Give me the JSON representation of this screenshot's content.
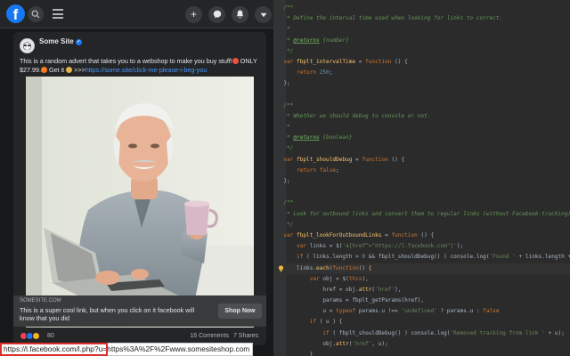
{
  "facebook": {
    "logo": "f",
    "nav_icons": [
      "search-icon",
      "menu-icon",
      "plus-icon",
      "messenger-icon",
      "notifications-icon",
      "account-caret-icon"
    ],
    "post": {
      "author": "Some Site",
      "text_before": "This is a random advert that takes you to a webshop to make you buy stuff!",
      "text_price": " ONLY $27.99.",
      "text_getit": " Get it ",
      "text_arrows": " >>>",
      "link_text": "https://some.site/click-me-please-i-beg-you",
      "ad_domain": "SOMESITE.COM",
      "ad_title": "This is a super cool link, but when you click on it facebook will know that you did",
      "ad_button": "Shop Now",
      "reaction_count": "80",
      "comments": "16 Comments",
      "shares": "7 Shares"
    },
    "status_url": "https://l.facebook.com/l.php?u=https%3A%2F%2Fwww.somesiteshop.com",
    "colors": {
      "facebook_blue": "#1877f2",
      "link": "#4599ff",
      "highlight_box": "#d9302c"
    }
  },
  "editor": {
    "lines": [
      [
        [
          "c-doc",
          "/**"
        ]
      ],
      [
        [
          "c-doc",
          " * Define the interval time used when looking for links to correct."
        ]
      ],
      [
        [
          "c-doc",
          " *"
        ]
      ],
      [
        [
          "c-doc",
          " * "
        ],
        [
          "c-tag",
          "@returns"
        ],
        [
          "c-doc",
          " {number}"
        ]
      ],
      [
        [
          "c-doc",
          " */"
        ]
      ],
      [
        [
          "c-kw",
          "var "
        ],
        [
          "c-fn",
          "fbplt_intervalTime"
        ],
        [
          "",
          " = "
        ],
        [
          "c-kw",
          "function"
        ],
        [
          "",
          " () {"
        ]
      ],
      [
        [
          "",
          "    "
        ],
        [
          "c-kw",
          "return "
        ],
        [
          "c-num",
          "250"
        ],
        [
          "",
          ";"
        ]
      ],
      [
        [
          "",
          "};"
        ]
      ],
      [
        [
          "",
          ""
        ]
      ],
      [
        [
          "c-doc",
          "/**"
        ]
      ],
      [
        [
          "c-doc",
          " * Whether we should debug to console or not."
        ]
      ],
      [
        [
          "c-doc",
          " *"
        ]
      ],
      [
        [
          "c-doc",
          " * "
        ],
        [
          "c-tag",
          "@returns"
        ],
        [
          "c-doc",
          " {boolean}"
        ]
      ],
      [
        [
          "c-doc",
          " */"
        ]
      ],
      [
        [
          "c-kw",
          "var "
        ],
        [
          "c-fn",
          "fbplt_shouldDebug"
        ],
        [
          "",
          " = "
        ],
        [
          "c-kw",
          "function"
        ],
        [
          "",
          " () {"
        ]
      ],
      [
        [
          "",
          "    "
        ],
        [
          "c-kw",
          "return false"
        ],
        [
          "",
          ";"
        ]
      ],
      [
        [
          "",
          "};"
        ]
      ],
      [
        [
          "",
          ""
        ]
      ],
      [
        [
          "c-doc",
          "/**"
        ]
      ],
      [
        [
          "c-doc",
          " * Look for outbound links and convert them to regular links (without Facebook-tracking)."
        ]
      ],
      [
        [
          "c-doc",
          " */"
        ]
      ],
      [
        [
          "c-kw",
          "var "
        ],
        [
          "c-fn",
          "fbplt_lookForOutboundLinks"
        ],
        [
          "",
          " = "
        ],
        [
          "c-kw",
          "function"
        ],
        [
          "",
          " () {"
        ]
      ],
      [
        [
          "",
          "    "
        ],
        [
          "c-kw",
          "var "
        ],
        [
          "",
          "links = $("
        ],
        [
          "c-str",
          "'a[href^=\"https://l.facebook.com\"]'"
        ],
        [
          "",
          ");"
        ]
      ],
      [
        [
          "",
          "    "
        ],
        [
          "c-kw",
          "if "
        ],
        [
          "",
          "( links.length > "
        ],
        [
          "c-num",
          "0"
        ],
        [
          "",
          " && fbplt_shouldDebug() ) console.log("
        ],
        [
          "c-str",
          "'Found '"
        ],
        [
          "",
          " + links.length + "
        ],
        [
          "c-str",
          "' links t"
        ]
      ],
      [
        [
          "",
          "    links."
        ],
        [
          "c-fn",
          "each"
        ],
        [
          "",
          "("
        ],
        [
          "c-kw",
          "function"
        ],
        [
          "",
          "() "
        ],
        [
          "c-brace",
          "{"
        ]
      ],
      [
        [
          "",
          "        "
        ],
        [
          "c-kw",
          "var "
        ],
        [
          "",
          "obj = $("
        ],
        [
          "c-kw",
          "this"
        ],
        [
          "",
          "),"
        ]
      ],
      [
        [
          "",
          "            href = obj."
        ],
        [
          "c-fn",
          "attr"
        ],
        [
          "",
          "("
        ],
        [
          "c-str",
          "'href'"
        ],
        [
          "",
          "),"
        ]
      ],
      [
        [
          "",
          "            params = fbplt_getParams(href),"
        ]
      ],
      [
        [
          "",
          "            u = "
        ],
        [
          "c-kw",
          "typeof "
        ],
        [
          "",
          "params.u !== "
        ],
        [
          "c-str",
          "'undefined'"
        ],
        [
          "",
          " ? params.u : "
        ],
        [
          "c-kw",
          "false"
        ]
      ],
      [
        [
          "",
          "        "
        ],
        [
          "c-kw",
          "if "
        ],
        [
          "",
          "( u ) {"
        ]
      ],
      [
        [
          "",
          "            "
        ],
        [
          "c-kw",
          "if "
        ],
        [
          "",
          "( fbplt_shouldDebug() ) console.log("
        ],
        [
          "c-str",
          "'Removed tracking from link '"
        ],
        [
          "",
          " + u);"
        ]
      ],
      [
        [
          "",
          "            obj."
        ],
        [
          "c-fn",
          "attr"
        ],
        [
          "",
          "("
        ],
        [
          "c-str",
          "'href'"
        ],
        [
          "",
          ", u);"
        ]
      ],
      [
        [
          "",
          "        }"
        ]
      ],
      [
        [
          "",
          "    "
        ],
        [
          "c-brace",
          "}"
        ],
        [
          "",
          ");"
        ]
      ]
    ],
    "highlight_line": 24,
    "colors": {
      "background": "#2b2b2b",
      "comment": "#629755",
      "keyword": "#cc7832",
      "function": "#ffc66d",
      "string": "#6a8759",
      "number": "#6897bb"
    }
  }
}
